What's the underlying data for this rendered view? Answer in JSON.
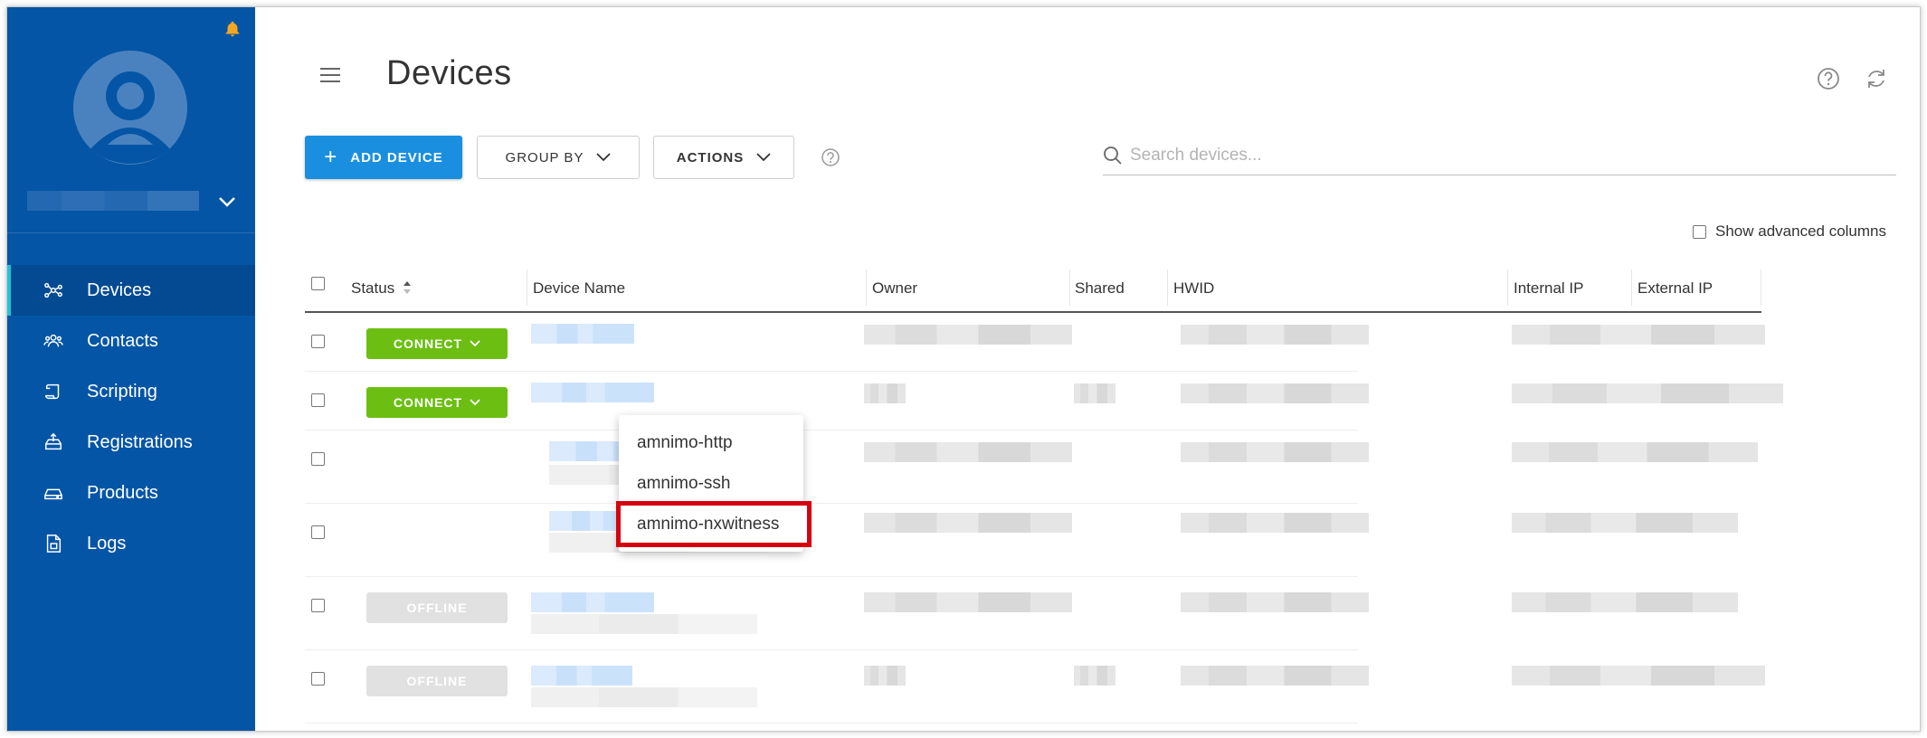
{
  "sidebar": {
    "nav": [
      {
        "label": "Devices",
        "icon": "devices-network-icon",
        "active": true
      },
      {
        "label": "Contacts",
        "icon": "contacts-people-icon"
      },
      {
        "label": "Scripting",
        "icon": "scripting-scroll-icon"
      },
      {
        "label": "Registrations",
        "icon": "registrations-upload-icon"
      },
      {
        "label": "Products",
        "icon": "products-drive-icon"
      },
      {
        "label": "Logs",
        "icon": "logs-document-icon"
      }
    ],
    "colors": {
      "background": "#0455a6",
      "active_bg": "#034a93",
      "active_accent": "#1fc3d8",
      "bell": "#f5a623"
    }
  },
  "header": {
    "title": "Devices"
  },
  "toolbar": {
    "add_device_label": "ADD DEVICE",
    "group_by_label": "GROUP BY",
    "actions_label": "ACTIONS",
    "search_placeholder": "Search devices...",
    "show_advanced_label": "Show advanced columns",
    "primary_color": "#1a8fe0"
  },
  "table": {
    "columns": [
      "Status",
      "Device Name",
      "Owner",
      "Shared",
      "HWID",
      "Internal IP",
      "External IP"
    ],
    "rows": [
      {
        "status": "CONNECT",
        "type": "connect"
      },
      {
        "status": "CONNECT",
        "type": "connect"
      },
      {
        "status": "",
        "type": "hidden"
      },
      {
        "status": "",
        "type": "hidden"
      },
      {
        "status": "OFFLINE",
        "type": "offline"
      },
      {
        "status": "OFFLINE",
        "type": "offline"
      }
    ],
    "connect_color": "#6cbf12",
    "offline_color": "#e1e1e1"
  },
  "connect_menu": {
    "items": [
      "amnimo-http",
      "amnimo-ssh",
      "amnimo-nxwitness"
    ],
    "highlighted": "amnimo-nxwitness",
    "highlight_color": "#d6000f"
  }
}
